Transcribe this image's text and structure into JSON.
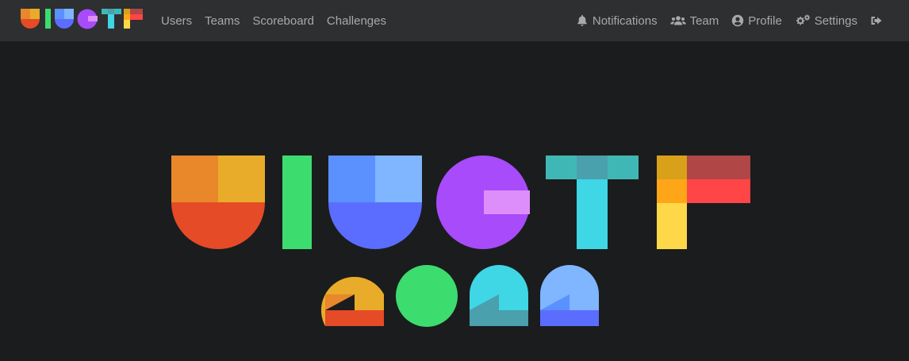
{
  "navbar": {
    "brand_logo": "uiuctf-logo",
    "links_left": [
      {
        "label": "Users"
      },
      {
        "label": "Teams"
      },
      {
        "label": "Scoreboard"
      },
      {
        "label": "Challenges"
      }
    ],
    "links_right": [
      {
        "label": "Notifications",
        "icon": "bell-icon"
      },
      {
        "label": "Team",
        "icon": "users-icon"
      },
      {
        "label": "Profile",
        "icon": "user-circle-icon"
      },
      {
        "label": "Settings",
        "icon": "cogs-icon"
      },
      {
        "label": "",
        "icon": "sign-out-icon"
      }
    ]
  },
  "hero": {
    "logo_letters": "UIUCTF",
    "logo_year": "2022"
  },
  "colors": {
    "navbar_bg": "#2d2f31",
    "page_bg": "#1b1c1e",
    "nav_text": "#a7a9ab"
  }
}
